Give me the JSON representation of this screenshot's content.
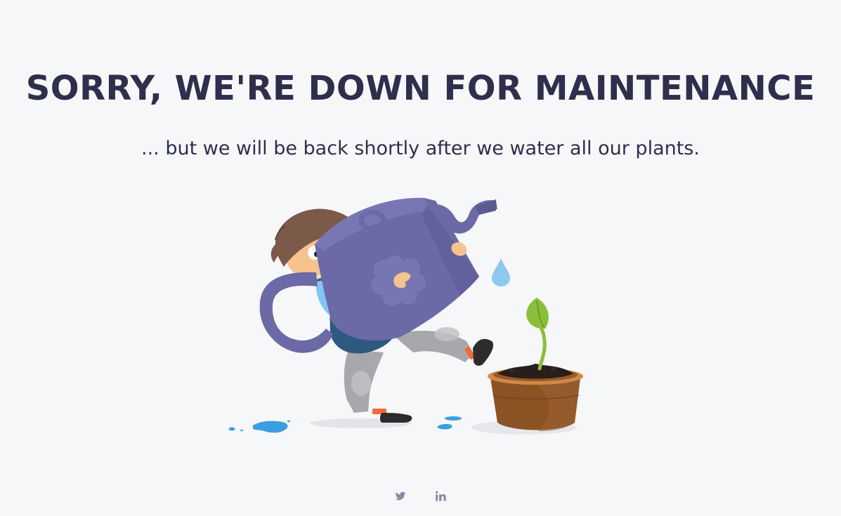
{
  "page": {
    "title": "SORRY, WE'RE DOWN FOR MAINTENANCE",
    "subtitle": "... but we will be back shortly after we water all our plants."
  },
  "illustration": {
    "icon": "man-watering-plant-illustration"
  },
  "footer": {
    "links": [
      {
        "icon": "twitter-icon"
      },
      {
        "icon": "linkedin-icon"
      }
    ]
  },
  "colors": {
    "background": "#f6f7f9",
    "heading": "#2f2e4d",
    "social_icon": "#8a89aa",
    "watering_can": "#6b6aa6",
    "shirt": "#7fc6f2",
    "pot": "#8b5224",
    "leaf": "#8bbf3a",
    "water": "#3a9ee0"
  }
}
